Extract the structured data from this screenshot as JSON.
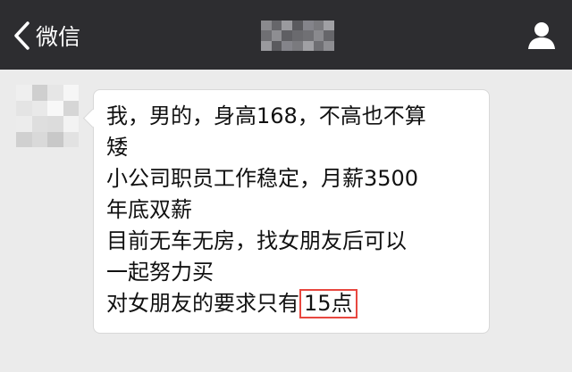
{
  "nav": {
    "back_label": "微信",
    "back_icon": "chevron-left-icon",
    "title_blurred": true,
    "profile_icon": "person-icon",
    "background": "#2d2d30"
  },
  "message": {
    "lines": [
      "我，男的，身高168，不高也不算",
      "矮",
      "小公司职员工作稳定，月薪3500",
      "年底双薪",
      "目前无车无房，找女朋友后可以",
      "一起努力买"
    ],
    "last_line_prefix": "对女朋友的要求只有",
    "highlighted": "15点",
    "highlight_color": "#e8473f"
  }
}
